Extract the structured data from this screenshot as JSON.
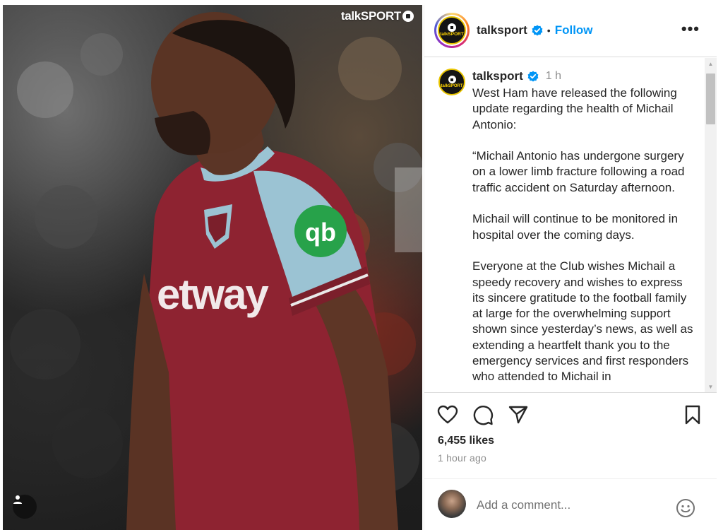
{
  "photo": {
    "watermark": "talkSPORT",
    "shirt_sponsor": "etway",
    "alt_subject": "player-photo"
  },
  "header": {
    "username": "talksport",
    "separator": "•",
    "follow_label": "Follow",
    "more_label": "•••",
    "logo_text": "talkSPORT"
  },
  "caption": {
    "username": "talksport",
    "time": "1 h",
    "text": "West Ham have released the following update regarding the health of Michail Antonio:\n\n“Michail Antonio has undergone surgery on a lower limb fracture following a road traffic accident on Saturday afternoon.\n\nMichail will continue to be monitored in hospital over the coming days.\n\nEveryone at the Club wishes Michail a speedy recovery and wishes to express its sincere gratitude to the football family at large for the overwhelming support shown since yesterday’s news, as well as extending a heartfelt thank you to the emergency services and first responders who attended to Michail in"
  },
  "stats": {
    "likes": "6,455 likes",
    "time_ago": "1 hour ago"
  },
  "comment_box": {
    "placeholder": "Add a comment..."
  },
  "colors": {
    "link_blue": "#0095f6",
    "verified_blue": "#0095f6",
    "muted": "#8e8e8e",
    "brand_yellow": "#ffd400"
  }
}
